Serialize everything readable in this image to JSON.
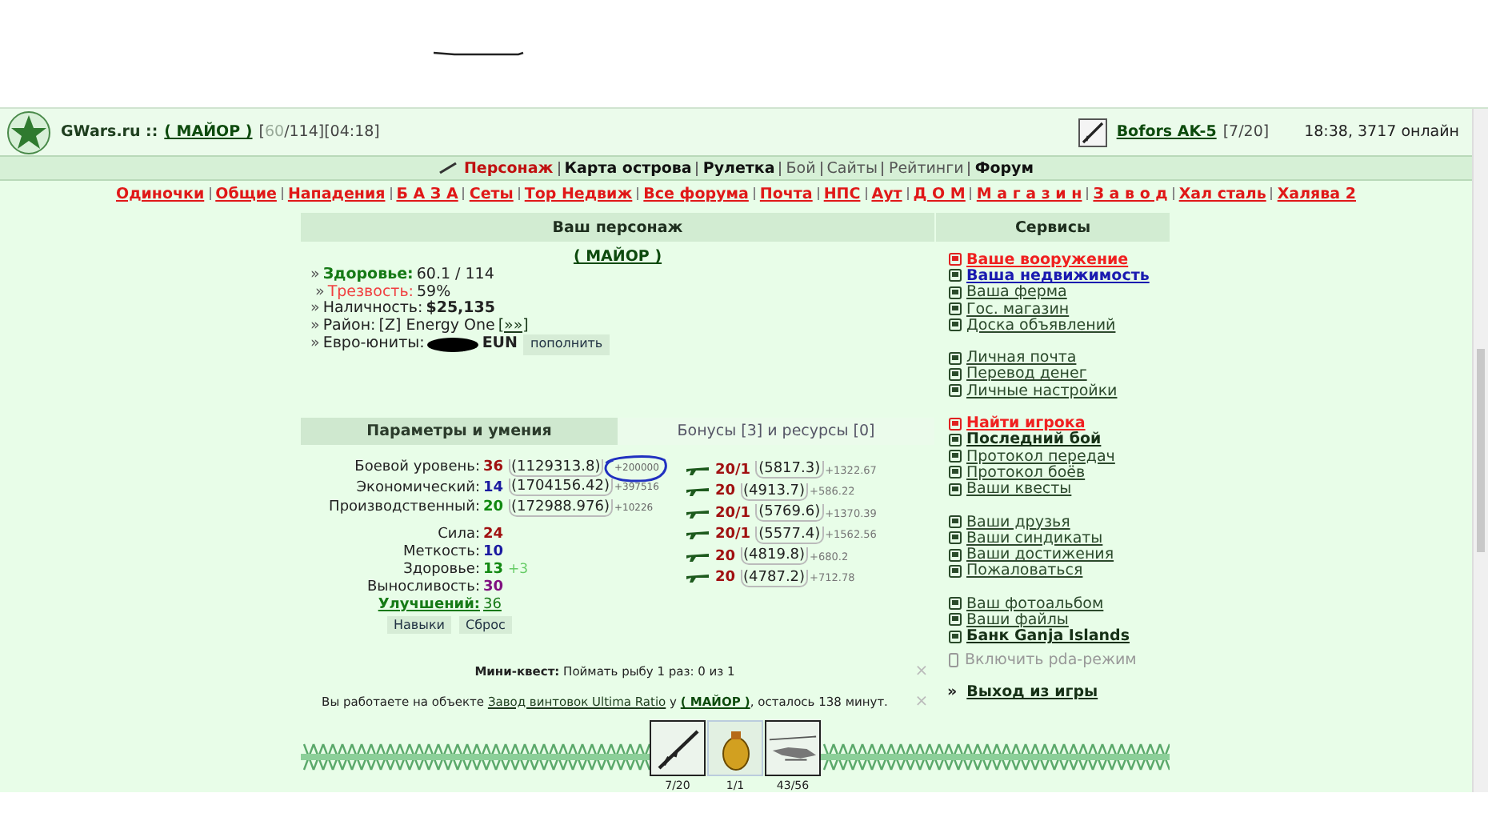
{
  "header": {
    "site": "GWars.ru ::",
    "player": "(  МАЙОР  )",
    "hp_current": "60",
    "hp_rest": "/114][04:18]",
    "hp_open": "[",
    "weapon": "Bofors AK-5",
    "ammo": "[7/20]",
    "clock": "18:38, 3717 онлайн"
  },
  "nav_main": [
    {
      "label": "Персонаж",
      "kind": "current"
    },
    {
      "label": "Карта острова",
      "kind": "bold"
    },
    {
      "label": "Рулетка",
      "kind": "bold"
    },
    {
      "label": "Бой",
      "kind": "plain"
    },
    {
      "label": "Сайты",
      "kind": "plain"
    },
    {
      "label": "Рейтинги",
      "kind": "plain"
    },
    {
      "label": "Форум",
      "kind": "bold"
    }
  ],
  "nav_forums": [
    "Одиночки",
    "Общие",
    "Нападения",
    "Б А З А",
    "Сеты",
    "Тор Недвиж",
    "Все форума",
    "Почта",
    "НПС",
    "Аут",
    "Д О М",
    "М а г а з и н",
    "З а в о д",
    "Хал сталь",
    "Халява 2"
  ],
  "character": {
    "title": "Ваш персонаж",
    "bullets": [
      "»",
      "»",
      "»",
      "»",
      "»"
    ],
    "name": "(  МАЙОР  )",
    "health_label": "Здоровье:",
    "health": "60.1 / 114",
    "sobriety_label": "Трезвость:",
    "sobriety": "59%",
    "cash_label": "Наличность:",
    "cash": "$25,135",
    "district_label": "Район:",
    "district": "[Z] Energy One",
    "district_link": "[»»]",
    "euro_label": "Евро-юниты:",
    "euro_unit": "EUN",
    "topup": "пополнить"
  },
  "tabs": [
    {
      "label": "Параметры и умения",
      "selected": true
    },
    {
      "label": "Бонусы [3] и ресурсы [0]",
      "selected": false
    }
  ],
  "levels": [
    {
      "label": "Боевой уровень:",
      "value": "36",
      "color": "#a01010",
      "exp": "(1129313.8)",
      "gain": "+200000"
    },
    {
      "label": "Экономический:",
      "value": "14",
      "color": "#1a1aa0",
      "exp": "(1704156.42)",
      "gain": "+397516"
    },
    {
      "label": "Производственный:",
      "value": "20",
      "color": "#118811",
      "exp": "(172988.976)",
      "gain": "+10226"
    }
  ],
  "stats": [
    {
      "label": "Сила:",
      "value": "24",
      "color": "#a01010"
    },
    {
      "label": "Меткость:",
      "value": "10",
      "color": "#1a1aa0"
    },
    {
      "label": "Здоровье:",
      "value": "13",
      "color": "#118811",
      "bonus": "+3"
    },
    {
      "label": "Выносливость:",
      "value": "30",
      "color": "#801080"
    }
  ],
  "upgrades_label": "Улучшений:",
  "upgrades": "36",
  "skill_buttons": [
    "Навыки",
    "Сброс"
  ],
  "weapon_skills": [
    {
      "level": "20/1",
      "exp": "(5817.3)",
      "gain": "+1322.67"
    },
    {
      "level": "20",
      "exp": "(4913.7)",
      "gain": "+586.22"
    },
    {
      "level": "20/1",
      "exp": "(5769.6)",
      "gain": "+1370.39"
    },
    {
      "level": "20/1",
      "exp": "(5577.4)",
      "gain": "+1562.56"
    },
    {
      "level": "20",
      "exp": "(4819.8)",
      "gain": "+680.2"
    },
    {
      "level": "20",
      "exp": "(4787.2)",
      "gain": "+712.78"
    }
  ],
  "services": {
    "title": "Сервисы",
    "groups": [
      [
        {
          "label": "Ваше вооружение",
          "kind": "alert"
        },
        {
          "label": "Ваша недвижимость",
          "kind": "highlight"
        },
        {
          "label": "Ваша ферма",
          "kind": "normal"
        },
        {
          "label": "Гос. магазин",
          "kind": "normal"
        },
        {
          "label": "Доска объявлений",
          "kind": "normal"
        }
      ],
      [
        {
          "label": "Личная почта",
          "kind": "normal"
        },
        {
          "label": "Перевод денег",
          "kind": "normal"
        },
        {
          "label": "Личные настройки",
          "kind": "normal"
        }
      ],
      [
        {
          "label": "Найти игрока",
          "kind": "alert"
        },
        {
          "label": "Последний бой",
          "kind": "bold"
        },
        {
          "label": "Протокол передач",
          "kind": "normal"
        },
        {
          "label": "Протокол боёв",
          "kind": "normal"
        },
        {
          "label": "Ваши квесты",
          "kind": "normal"
        }
      ],
      [
        {
          "label": "Ваши друзья",
          "kind": "normal"
        },
        {
          "label": "Ваши синдикаты",
          "kind": "normal"
        },
        {
          "label": "Ваши достижения",
          "kind": "normal"
        },
        {
          "label": "Пожаловаться",
          "kind": "normal"
        }
      ],
      [
        {
          "label": "Ваш фотоальбом",
          "kind": "normal"
        },
        {
          "label": "Ваши файлы",
          "kind": "normal"
        },
        {
          "label": "Банк Ganja Islands",
          "kind": "bold"
        }
      ]
    ]
  },
  "mini_quest": {
    "label": "Мини-квест:",
    "text": "Поймать рыбу 1 раз: 0 из 1",
    "close": "×"
  },
  "work": {
    "before": "Вы работаете на объекте",
    "place": "Завод винтовок Ultima Ratio",
    "mid": "у",
    "owner": "(  МАЙОР  )",
    "after": ", осталось 138 минут.",
    "close": "×"
  },
  "pda": "Включить pda-режим",
  "exit_mark": "»",
  "exit": "Выход из игры",
  "inventory": [
    {
      "kind": "rifle",
      "count": "7/20"
    },
    {
      "kind": "grenade",
      "count": "1/1"
    },
    {
      "kind": "helicopter",
      "count": "43/56"
    }
  ]
}
